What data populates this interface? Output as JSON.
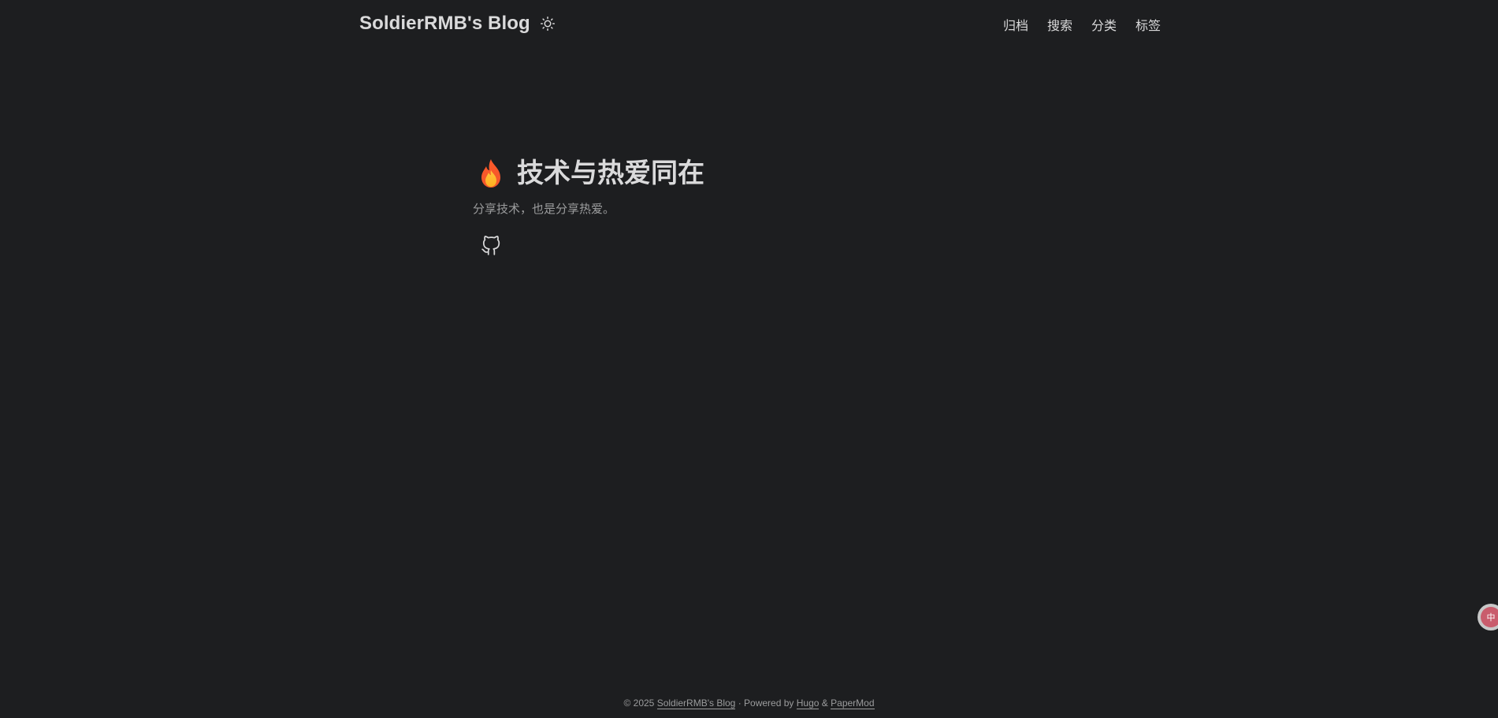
{
  "header": {
    "logo_text": "SoldierRMB's Blog",
    "theme_toggle_icon": "sun-icon",
    "nav": [
      {
        "label": "归档"
      },
      {
        "label": "搜索"
      },
      {
        "label": "分类"
      },
      {
        "label": "标签"
      }
    ]
  },
  "home_info": {
    "title_icon": "flame-icon",
    "title": "技术与热爱同在",
    "subtitle": "分享技术，也是分享热爱。",
    "social": [
      {
        "icon": "github-icon"
      }
    ]
  },
  "footer": {
    "copyright": "© 2025",
    "site_link": "SoldierRMB's Blog",
    "separator": "· Powered by",
    "hugo_link": "Hugo",
    "amp": "&",
    "theme_link": "PaperMod"
  },
  "float_widget": {
    "label": "中"
  },
  "colors": {
    "background": "#1d1e20",
    "primary_text": "#dadadb",
    "secondary_text": "#9b9c9d"
  }
}
